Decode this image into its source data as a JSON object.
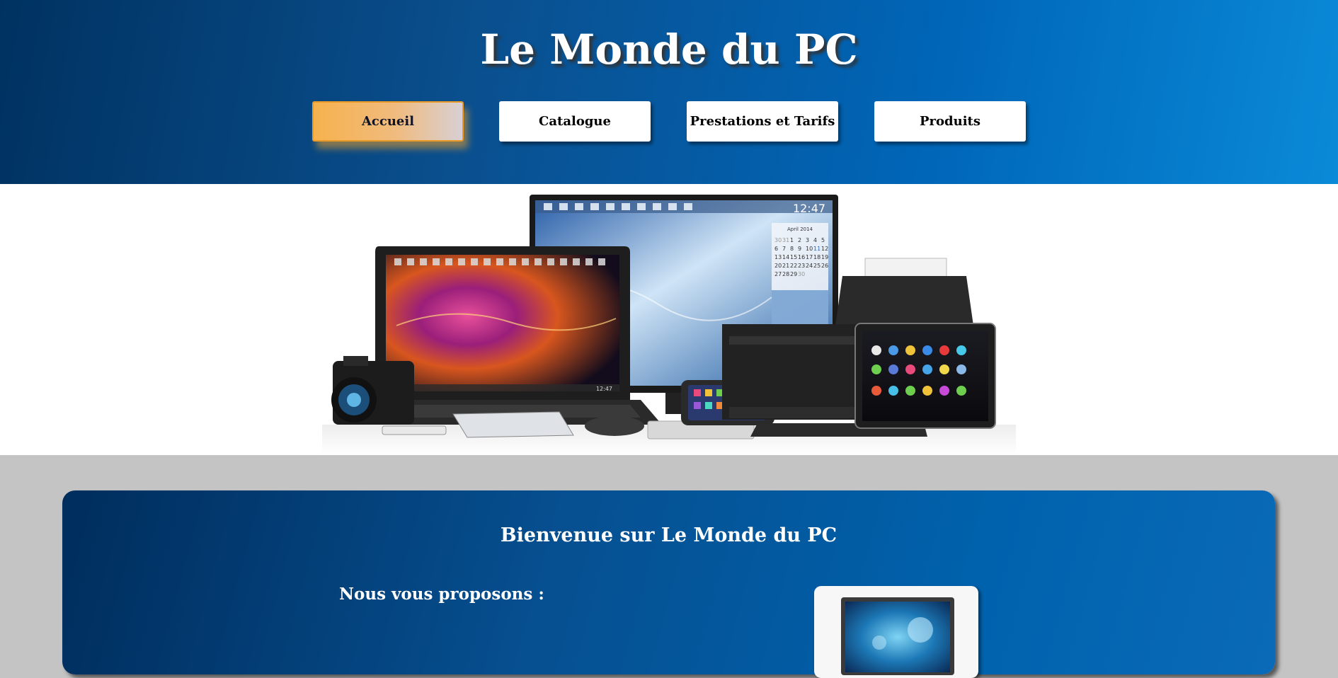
{
  "header": {
    "title": "Le Monde du PC",
    "nav": [
      {
        "label": "Accueil",
        "active": true
      },
      {
        "label": "Catalogue",
        "active": false
      },
      {
        "label": "Prestations et Tarifs",
        "active": false
      },
      {
        "label": "Produits",
        "active": false
      }
    ]
  },
  "hero": {
    "image": "devices-collage",
    "monitor_clock": "12:47",
    "laptop_clock": "12:47",
    "calendar_month": "April 2014",
    "calendar_days": [
      "30",
      "31",
      "1",
      "2",
      "3",
      "4",
      "5",
      "6",
      "7",
      "8",
      "9",
      "10",
      "11",
      "12",
      "13",
      "14",
      "15",
      "16",
      "17",
      "18",
      "19",
      "20",
      "21",
      "22",
      "23",
      "24",
      "25",
      "26",
      "27",
      "28",
      "29",
      "30"
    ]
  },
  "welcome": {
    "title": "Bienvenue sur Le Monde du PC",
    "subtitle": "Nous vous proposons :",
    "image": "laptop-thumbnail"
  },
  "colors": {
    "header_start": "#003261",
    "header_end": "#0a8ad8",
    "active_button": "#f7b24e",
    "page_background": "#c4c4c5"
  }
}
